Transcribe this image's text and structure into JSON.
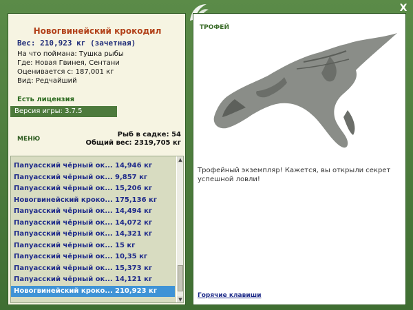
{
  "window": {
    "close_label": "X"
  },
  "fish": {
    "name": "Новогвинейский крокодил",
    "weight_line": "Вес: 210,923 кг (зачетная)",
    "bait": "На что поймана: Тушка рыбы",
    "location": "Где: Новая Гвинея, Сентани",
    "valued": "Оценивается с: 187,001 кг",
    "kind": "Вид: Редчайший"
  },
  "license": "Есть лицензия",
  "version": "Версия игры: 3.7.5",
  "menu_label": "МЕНЮ",
  "stats": {
    "count": "Рыб в садке: 54",
    "total": "Общий вес: 2319,705 кг"
  },
  "catch_list": [
    {
      "name": "Папуасский чёрный ок...",
      "weight": "14,946 кг"
    },
    {
      "name": "Папуасский чёрный ок...",
      "weight": "9,857 кг"
    },
    {
      "name": "Папуасский чёрный ок...",
      "weight": "15,206 кг"
    },
    {
      "name": "Новогвинейский кроко...",
      "weight": "175,136 кг"
    },
    {
      "name": "Папуасский чёрный ок...",
      "weight": "14,494 кг"
    },
    {
      "name": "Папуасский чёрный ок...",
      "weight": "14,072 кг"
    },
    {
      "name": "Папуасский чёрный ок...",
      "weight": "14,321 кг"
    },
    {
      "name": "Папуасский чёрный ок...",
      "weight": "15 кг"
    },
    {
      "name": "Папуасский чёрный ок...",
      "weight": "10,35 кг"
    },
    {
      "name": "Папуасский чёрный ок...",
      "weight": "15,373 кг"
    },
    {
      "name": "Папуасский чёрный ок...",
      "weight": "14,121 кг"
    },
    {
      "name": "Новогвинейский кроко...",
      "weight": "210,923 кг",
      "selected": true
    }
  ],
  "trophy": {
    "title": "ТРОФЕЙ",
    "text": "Трофейный экземпляр! Кажется, вы открыли секрет успешной ловли!"
  },
  "hotkeys_label": "Горячие клавиши",
  "colors": {
    "frame": "#4a7a3a",
    "panel": "#f6f4e2",
    "name": "#b2421a",
    "list_text": "#1e2a8a",
    "selected": "#3f93d6"
  }
}
